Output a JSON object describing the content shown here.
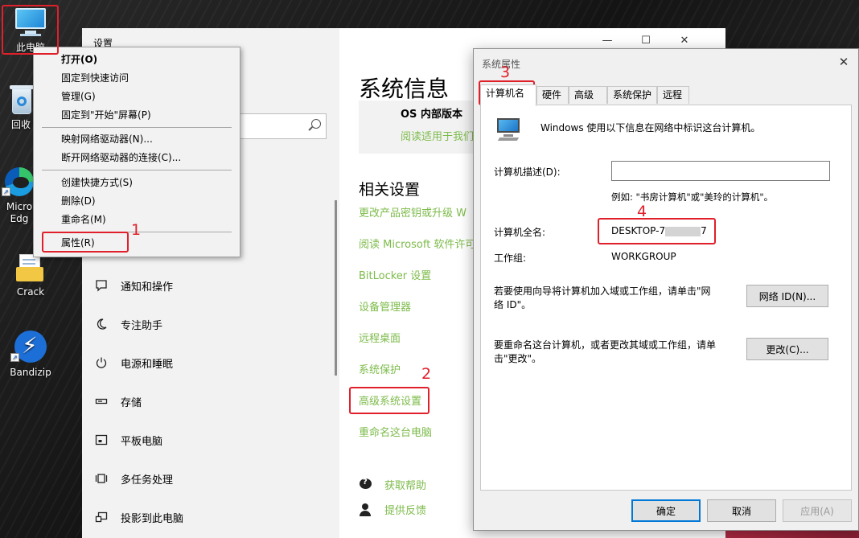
{
  "desktop": {
    "icons": [
      {
        "label": "此电脑",
        "icon": "computer-icon"
      },
      {
        "label": "回收",
        "icon": "recycle-bin-icon"
      },
      {
        "label": "Micro Edg",
        "icon": "edge-icon"
      },
      {
        "label": "Crack",
        "icon": "document-folder-icon"
      },
      {
        "label": "Bandizip",
        "icon": "bandizip-icon"
      }
    ]
  },
  "context_menu": {
    "items": [
      {
        "label": "打开(O)",
        "bold": true
      },
      {
        "label": "固定到快速访问"
      },
      {
        "label": "管理(G)"
      },
      {
        "label": "固定到\"开始\"屏幕(P)"
      },
      {
        "label": "映射网络驱动器(N)..."
      },
      {
        "label": "断开网络驱动器的连接(C)..."
      },
      {
        "label": "创建快捷方式(S)"
      },
      {
        "label": "删除(D)"
      },
      {
        "label": "重命名(M)"
      },
      {
        "label": "属性(R)"
      }
    ]
  },
  "settings": {
    "title": "设置",
    "nav_items": [
      {
        "label": "通知和操作",
        "icon": "notification-icon"
      },
      {
        "label": "专注助手",
        "icon": "moon-icon"
      },
      {
        "label": "电源和睡眠",
        "icon": "power-icon"
      },
      {
        "label": "存储",
        "icon": "storage-icon"
      },
      {
        "label": "平板电脑",
        "icon": "tablet-icon"
      },
      {
        "label": "多任务处理",
        "icon": "multitask-icon"
      },
      {
        "label": "投影到此电脑",
        "icon": "projector-icon"
      }
    ],
    "main": {
      "heading": "系统信息",
      "os_card_label": "OS 内部版本",
      "os_card_link": "阅读适用于我们",
      "related_heading": "相关设置",
      "links": [
        "更改产品密钥或升级 W",
        "阅读 Microsoft 软件许可",
        "BitLocker 设置",
        "设备管理器",
        "远程桌面",
        "系统保护",
        "高级系统设置",
        "重命名这台电脑"
      ],
      "help": {
        "get_help": "获取帮助",
        "feedback": "提供反馈"
      }
    }
  },
  "sysprop": {
    "title": "系统属性",
    "tabs": [
      "计算机名",
      "硬件",
      "高级",
      "系统保护",
      "远程"
    ],
    "intro": "Windows 使用以下信息在网络中标识这台计算机。",
    "desc_label": "计算机描述(D):",
    "desc_value": "",
    "desc_example": "例如: \"书房计算机\"或\"美玲的计算机\"。",
    "fullname_label": "计算机全名:",
    "fullname_value_start": "DESKTOP-7",
    "fullname_value_end": "7",
    "workgroup_label": "工作组:",
    "workgroup_value": "WORKGROUP",
    "network_text": "若要使用向导将计算机加入域或工作组，请单击\"网络 ID\"。",
    "network_btn": "网络 ID(N)...",
    "rename_text": "要重命名这台计算机，或者更改其域或工作组，请单击\"更改\"。",
    "change_btn": "更改(C)...",
    "ok_btn": "确定",
    "cancel_btn": "取消",
    "apply_btn": "应用(A)"
  },
  "annotations": {
    "n1": "1",
    "n2": "2",
    "n3": "3",
    "n4": "4"
  },
  "colors": {
    "annotation": "#e0202a",
    "link_green": "#7dbb4a",
    "accent_blue": "#0078d7"
  }
}
